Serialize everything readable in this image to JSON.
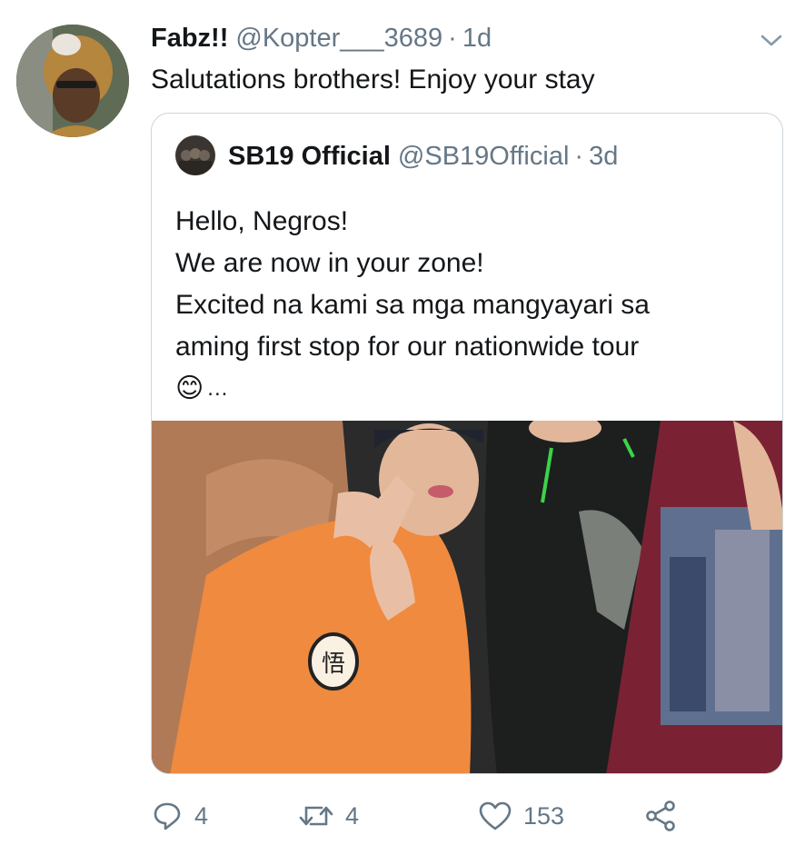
{
  "tweet": {
    "display_name": "Fabz!!",
    "handle": "@Kopter___3689",
    "separator": "·",
    "time": "1d",
    "text": "Salutations brothers! Enjoy your stay"
  },
  "quoted_tweet": {
    "display_name": "SB19 Official",
    "handle": "@SB19Official",
    "separator": "·",
    "time": "3d",
    "lines": [
      "Hello, Negros!",
      "We are now in your zone!",
      "Excited na kami sa mga mangyayari sa",
      "aming first stop for our nationwide tour"
    ],
    "emoji": "😊",
    "ellipsis": "..."
  },
  "actions": {
    "reply_count": "4",
    "retweet_count": "4",
    "like_count": "153"
  },
  "icons": {
    "caret": "chevron-down-icon",
    "reply": "reply-icon",
    "retweet": "retweet-icon",
    "like": "heart-icon",
    "share": "share-icon"
  },
  "colors": {
    "muted": "#657786",
    "border": "#ccd6dd",
    "text": "#14171a"
  }
}
